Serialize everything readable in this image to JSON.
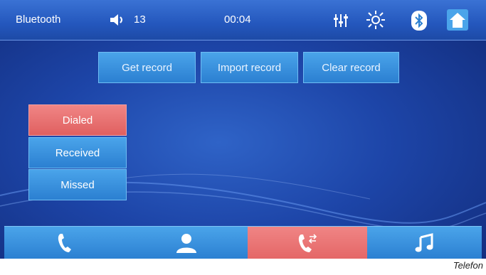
{
  "status_bar": {
    "title": "Bluetooth",
    "volume": "13",
    "time": "00:04",
    "icons": [
      "speaker-icon",
      "equalizer-icon",
      "brightness-icon",
      "bluetooth-icon",
      "home-icon"
    ]
  },
  "record_actions": [
    {
      "label": "Get record"
    },
    {
      "label": "Import record"
    },
    {
      "label": "Clear record"
    }
  ],
  "call_log_tabs": [
    {
      "label": "Dialed",
      "selected": true
    },
    {
      "label": "Received",
      "selected": false
    },
    {
      "label": "Missed",
      "selected": false
    }
  ],
  "dock": {
    "items": [
      {
        "icon": "phone-icon",
        "selected": false
      },
      {
        "icon": "contacts-icon",
        "selected": false
      },
      {
        "icon": "call-log-icon",
        "selected": true
      },
      {
        "icon": "music-icon",
        "selected": false
      }
    ]
  },
  "caption": "Telefon",
  "colors": {
    "accent_blue": "#2b7fd1",
    "selected_red": "#e06060",
    "background": "#1d45a8"
  }
}
